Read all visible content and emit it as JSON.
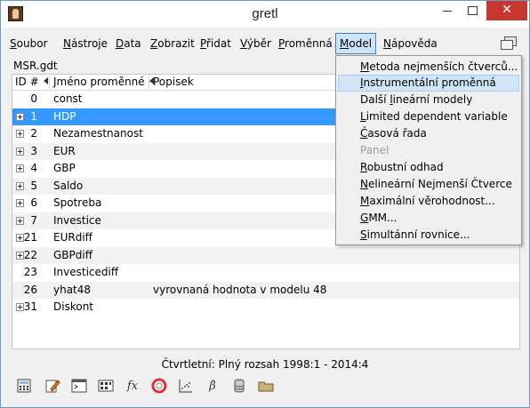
{
  "window": {
    "title": "gretl",
    "close": "✕"
  },
  "menubar": {
    "items": [
      {
        "key": "soubor",
        "mn": "S",
        "rest": "oubor"
      },
      {
        "key": "nastroje",
        "mn": "N",
        "rest": "ástroje"
      },
      {
        "key": "data",
        "mn": "D",
        "rest": "ata"
      },
      {
        "key": "zobrazit",
        "mn": "Z",
        "rest": "obrazit"
      },
      {
        "key": "pridat",
        "mn": "P",
        "rest": "řidat"
      },
      {
        "key": "vyber",
        "mn": "V",
        "rest": "ýběr"
      },
      {
        "key": "promenna",
        "mn": "P",
        "rest": "roměnná"
      },
      {
        "key": "model",
        "mn": "M",
        "rest": "odel"
      },
      {
        "key": "napoveda",
        "mn": "N",
        "rest": "ápověda"
      }
    ]
  },
  "file": {
    "name": "MSR.gdt"
  },
  "table": {
    "headers": {
      "id": "ID #",
      "name": "Jméno proměnné",
      "desc": "Popisek"
    },
    "rows": [
      {
        "id": "0",
        "name": "const",
        "desc": ""
      },
      {
        "id": "1",
        "name": "HDP",
        "desc": ""
      },
      {
        "id": "2",
        "name": "Nezamestnanost",
        "desc": ""
      },
      {
        "id": "3",
        "name": "EUR",
        "desc": ""
      },
      {
        "id": "4",
        "name": "GBP",
        "desc": ""
      },
      {
        "id": "5",
        "name": "Saldo",
        "desc": ""
      },
      {
        "id": "6",
        "name": "Spotreba",
        "desc": ""
      },
      {
        "id": "7",
        "name": "Investice",
        "desc": ""
      },
      {
        "id": "21",
        "name": "EURdiff",
        "desc": ""
      },
      {
        "id": "22",
        "name": "GBPdiff",
        "desc": ""
      },
      {
        "id": "23",
        "name": "Investicediff",
        "desc": ""
      },
      {
        "id": "26",
        "name": "yhat48",
        "desc": "vyrovnaná hodnota v modelu 48"
      },
      {
        "id": "31",
        "name": "Diskont",
        "desc": ""
      }
    ]
  },
  "model_menu": {
    "items": [
      {
        "pre": "",
        "mn": "M",
        "rest": "etoda nejmenších čtverců..."
      },
      {
        "pre": "",
        "mn": "I",
        "rest": "nstrumentální proměnná"
      },
      {
        "pre": "Další ",
        "mn": "l",
        "rest": "ineární modely"
      },
      {
        "pre": "",
        "mn": "L",
        "rest": "imited dependent variable"
      },
      {
        "pre": "",
        "mn": "Č",
        "rest": "asová řada"
      },
      {
        "pre": "",
        "mn": "",
        "rest": "Panel"
      },
      {
        "pre": "",
        "mn": "R",
        "rest": "obustní odhad"
      },
      {
        "pre": "",
        "mn": "N",
        "rest": "elineární Nejmenší Čtverce"
      },
      {
        "pre": "",
        "mn": "M",
        "rest": "aximální věrohodnost..."
      },
      {
        "pre": "",
        "mn": "G",
        "rest": "MM..."
      },
      {
        "pre": "",
        "mn": "S",
        "rest": "imultánní rovnice..."
      }
    ]
  },
  "status": {
    "text": "Čtvrtletní: Plný rozsah 1998:1 - 2014:4"
  },
  "toolbar": {
    "icons": [
      "calculator-icon",
      "edit-script-icon",
      "console-icon",
      "session-icons-icon",
      "function-icon",
      "help-lifebuoy-icon",
      "scatter-plot-icon",
      "beta-model-icon",
      "database-icon",
      "folder-icon"
    ],
    "function_glyph": "fx",
    "beta_glyph": "β̂"
  },
  "colors": {
    "selection": "#3399ff",
    "menu_highlight": "#cce4f7",
    "close_button": "#c7372f"
  }
}
